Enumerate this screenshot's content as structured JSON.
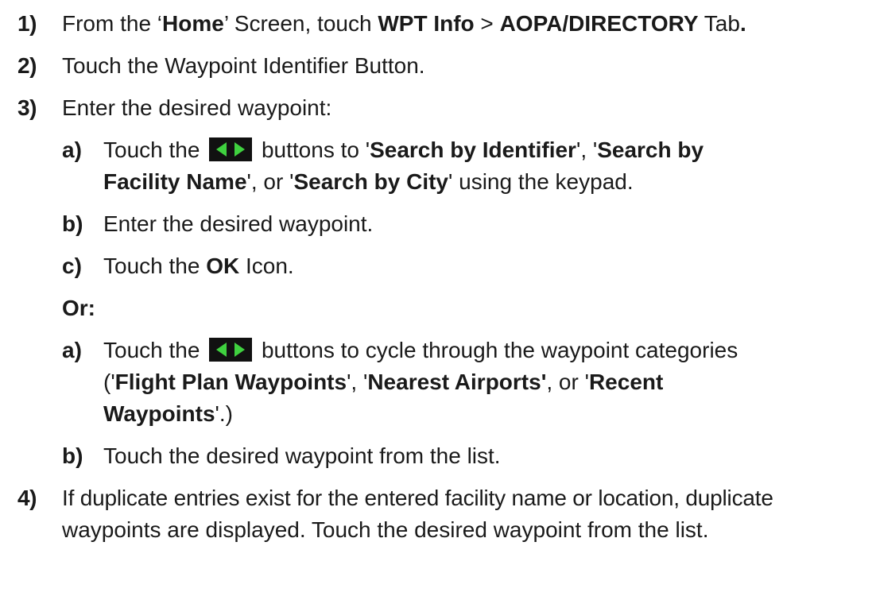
{
  "steps": {
    "s1": {
      "num": "1)",
      "t1": "From the ‘",
      "b1": "Home",
      "t2": "’ Screen, touch ",
      "b2": "WPT Info",
      "t3": " > ",
      "b3": "AOPA/DIRECTORY",
      "t4": " Tab",
      "t5": "."
    },
    "s2": {
      "num": "2)",
      "text": "Touch the Waypoint Identifier Button."
    },
    "s3": {
      "num": "3)",
      "text": "Enter the desired waypoint:",
      "a": {
        "num": "a)",
        "t1": "Touch the",
        "t2": " buttons to '",
        "b1": "Search by Identifier",
        "t3": "', '",
        "b2": "Search by",
        "b3": "Facility Name",
        "t4": "', or '",
        "b4": "Search by City",
        "t5": "' using the keypad."
      },
      "b": {
        "num": "b)",
        "text": "Enter the desired waypoint."
      },
      "c": {
        "num": "c)",
        "t1": "Touch the ",
        "b1": "OK",
        "t2": " Icon."
      },
      "or_label": "Or:",
      "a2": {
        "num": "a)",
        "t1": "Touch the",
        "t2": " buttons to cycle through the waypoint categories",
        "t3": "('",
        "b1": "Flight Plan Waypoints",
        "t4": "', '",
        "b2": "Nearest Airports'",
        "t5": ", or '",
        "b3": "Recent",
        "b4": "Waypoints",
        "t6": "'.)"
      },
      "b2": {
        "num": "b)",
        "text": "Touch the desired waypoint from the list."
      }
    },
    "s4": {
      "num": "4)",
      "line1": "If duplicate entries exist for the entered facility name or location, duplicate",
      "line2": "waypoints are displayed.  Touch the desired waypoint from the list."
    }
  },
  "icons": {
    "arrow_buttons": "left-right-arrow-buttons-icon",
    "arrow_color": "#3fd13f",
    "arrow_bg": "#111111"
  }
}
